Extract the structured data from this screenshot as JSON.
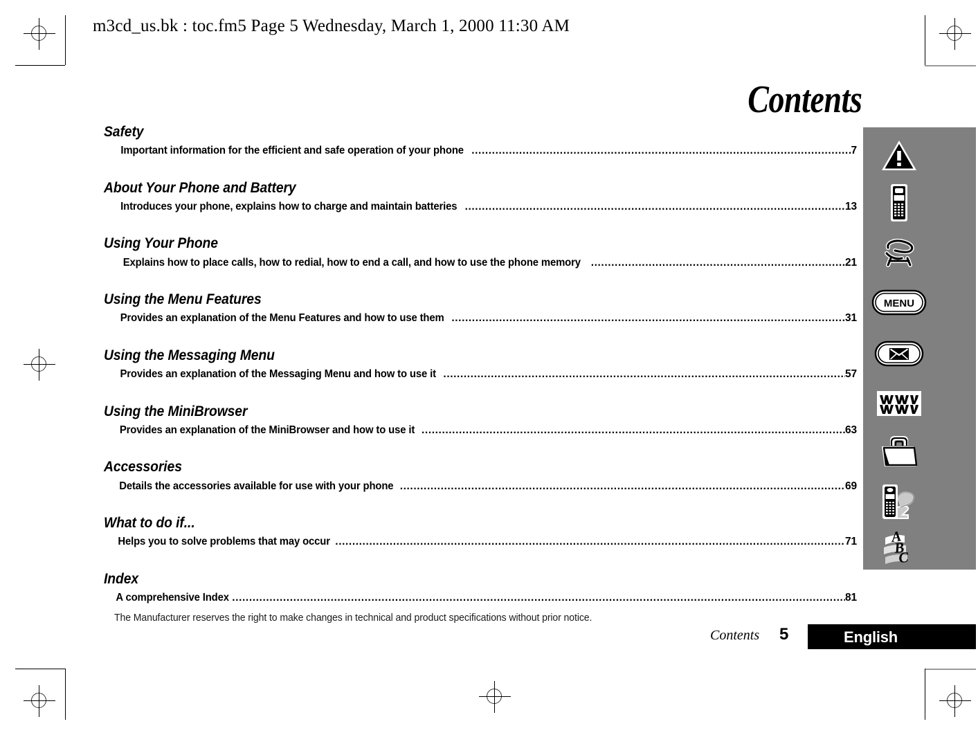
{
  "header": {
    "file_info": "m3cd_us.bk : toc.fm5  Page 5  Wednesday, March 1, 2000  11:30 AM"
  },
  "title": "Contents",
  "toc": {
    "entries": [
      {
        "heading": "Safety",
        "description": "Important information for the efficient and safe operation of your phone",
        "page": "7",
        "icon": "warning-triangle-icon"
      },
      {
        "heading": "About Your Phone and Battery",
        "description": "Introduces your phone, explains how to charge and maintain batteries",
        "page": "13",
        "icon": "mobile-phone-icon"
      },
      {
        "heading": "Using Your Phone",
        "description": "Explains how to place calls, how to redial, how to end a call, and how to use the phone memory",
        "page": "21",
        "icon": "handset-call-icon"
      },
      {
        "heading": "Using the Menu Features",
        "description": "Provides an explanation of the Menu Features and how to use them",
        "page": "31",
        "icon": "menu-button-icon"
      },
      {
        "heading": "Using the Messaging Menu",
        "description": "Provides an explanation of the Messaging Menu and how to use it",
        "page": "57",
        "icon": "envelope-icon"
      },
      {
        "heading": "Using the MiniBrowser",
        "description": "Provides an explanation of the MiniBrowser and how to use it",
        "page": "63",
        "icon": "www-zigzag-icon"
      },
      {
        "heading": "Accessories",
        "description": "Details the accessories available for use with your phone",
        "page": "69",
        "icon": "briefcase-icon"
      },
      {
        "heading": "What to do if...",
        "description": "Helps you to solve problems that may occur",
        "page": "71",
        "icon": "phone-question-icon"
      },
      {
        "heading": "Index",
        "description": "A comprehensive Index",
        "page": "81",
        "icon": "abc-icon"
      }
    ],
    "leader_dots": "........................................................................................................................................................................................................................................................................................................"
  },
  "sidebar": {
    "background_color": "#808080",
    "menu_button_label": "MENU",
    "abc_letters": [
      "A",
      "B",
      "C"
    ]
  },
  "footer": {
    "disclaimer": "The Manufacturer reserves the right to make changes in technical and product specifications without prior notice.",
    "section_label": "Contents",
    "page_number": "5",
    "language": "English",
    "language_bar_color": "#000000"
  }
}
